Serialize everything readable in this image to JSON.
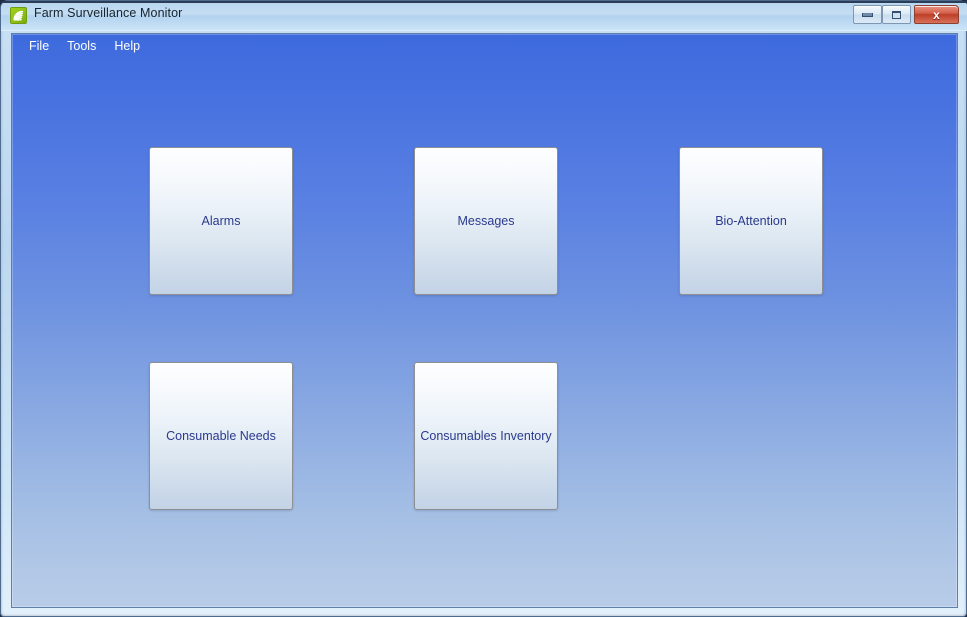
{
  "window": {
    "title": "Farm Surveillance Monitor",
    "icon": "signal-radar-icon",
    "icon_color": "#8cc017",
    "controls": {
      "minimize": "Minimize",
      "maximize": "Maximize",
      "close": "x"
    }
  },
  "menu": {
    "items": [
      {
        "label": "File"
      },
      {
        "label": "Tools"
      },
      {
        "label": "Help"
      }
    ]
  },
  "main": {
    "background_top_color": "#3d6ade",
    "background_bottom_color": "#b8cce8",
    "tile_text_color": "#2b3a8e",
    "tiles": [
      {
        "label": "Alarms"
      },
      {
        "label": "Messages"
      },
      {
        "label": "Bio-Attention"
      },
      {
        "label": "Consumable Needs"
      },
      {
        "label": "Consumables Inventory"
      }
    ]
  }
}
